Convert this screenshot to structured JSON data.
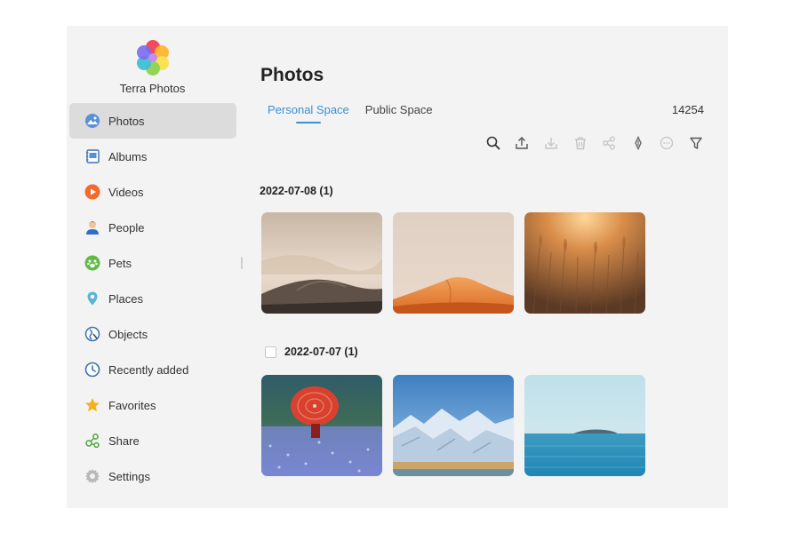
{
  "app": {
    "name": "Terra Photos"
  },
  "sidebar": {
    "items": [
      {
        "label": "Photos",
        "icon": "photos-icon",
        "active": true
      },
      {
        "label": "Albums",
        "icon": "albums-icon"
      },
      {
        "label": "Videos",
        "icon": "videos-icon"
      },
      {
        "label": "People",
        "icon": "people-icon"
      },
      {
        "label": "Pets",
        "icon": "pets-icon"
      },
      {
        "label": "Places",
        "icon": "places-icon"
      },
      {
        "label": "Objects",
        "icon": "objects-icon"
      },
      {
        "label": "Recently added",
        "icon": "recently-added-icon"
      },
      {
        "label": "Favorites",
        "icon": "favorites-icon"
      },
      {
        "label": "Share",
        "icon": "share-icon"
      },
      {
        "label": "Settings",
        "icon": "settings-icon"
      }
    ]
  },
  "main": {
    "title": "Photos",
    "tabs": [
      {
        "label": "Personal Space",
        "active": true
      },
      {
        "label": "Public Space"
      }
    ],
    "count": "14254",
    "toolbar": [
      "search-icon",
      "upload-icon",
      "download-icon",
      "delete-icon",
      "share-icon",
      "edit-icon",
      "more-icon",
      "filter-icon"
    ],
    "groups": [
      {
        "date": "2022-07-08 (1)",
        "photos": [
          "desert-haze-photo",
          "orange-dune-photo",
          "wheat-field-photo"
        ]
      },
      {
        "date": "2022-07-07 (1)",
        "photos": [
          "red-umbrella-photo",
          "snowy-mountains-photo",
          "blue-sea-photo"
        ]
      }
    ]
  },
  "colors": {
    "accent": "#3a8fd6",
    "sidebar_active": "#dcdcdc",
    "panel_bg": "#f3f3f3"
  }
}
